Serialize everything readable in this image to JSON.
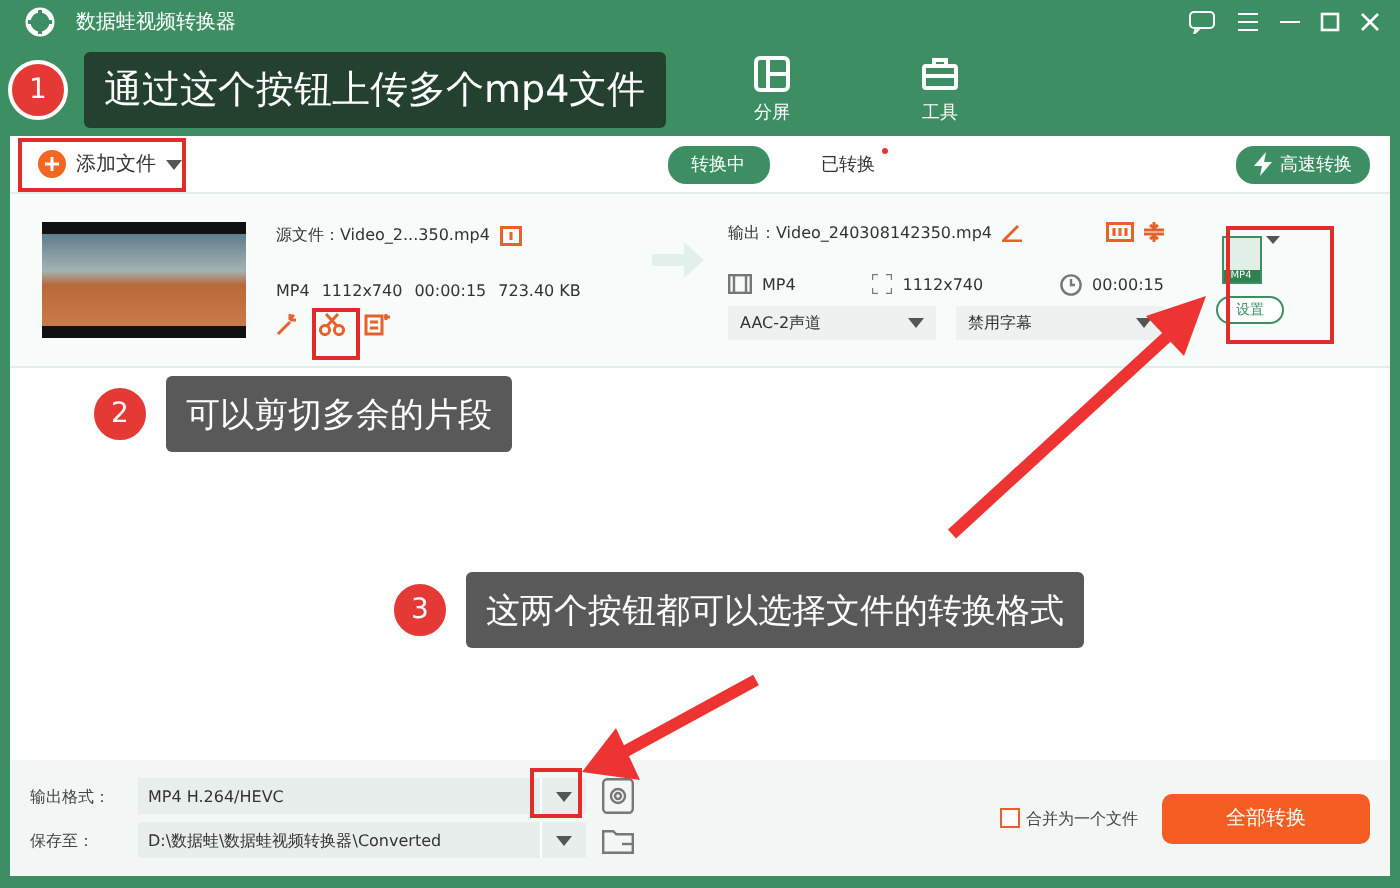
{
  "window": {
    "title": "数据蛙视频转换器"
  },
  "nav_tabs": [
    {
      "label": "分屏",
      "selected": false
    },
    {
      "label": "工具",
      "selected": false
    }
  ],
  "toolbar": {
    "add_button": "添加文件",
    "segments": [
      {
        "label": "转换中",
        "selected": true,
        "dot": false
      },
      {
        "label": "已转换",
        "selected": false,
        "dot": true
      }
    ],
    "fast_button": "高速转换"
  },
  "file": {
    "source": "源文件：Video_2...350.mp4",
    "format": "MP4",
    "resolution": "1112x740",
    "duration": "00:00:15",
    "size": "723.40 KB",
    "output": "输出：Video_240308142350.mp4",
    "out_format": "MP4",
    "out_resolution": "1112x740",
    "out_duration": "00:00:15",
    "audio": "AAC-2声道",
    "subtitle": "禁用字幕",
    "format_badge": "MP4",
    "settings": "设置"
  },
  "bottom": {
    "format_label": "输出格式：",
    "format_value": "MP4 H.264/HEVC",
    "save_label": "保存至：",
    "save_value": "D:\\数据蛙\\数据蛙视频转换器\\Converted",
    "merge": {
      "label": "合并为一个文件",
      "checked": false
    },
    "convert_all": "全部转换"
  },
  "callouts": [
    {
      "number": "1",
      "text": "通过这个按钮上传多个mp4文件"
    },
    {
      "number": "2",
      "text": "可以剪切多余的片段"
    },
    {
      "number": "3",
      "text": "这两个按钮都可以选择文件的转换格式"
    }
  ]
}
